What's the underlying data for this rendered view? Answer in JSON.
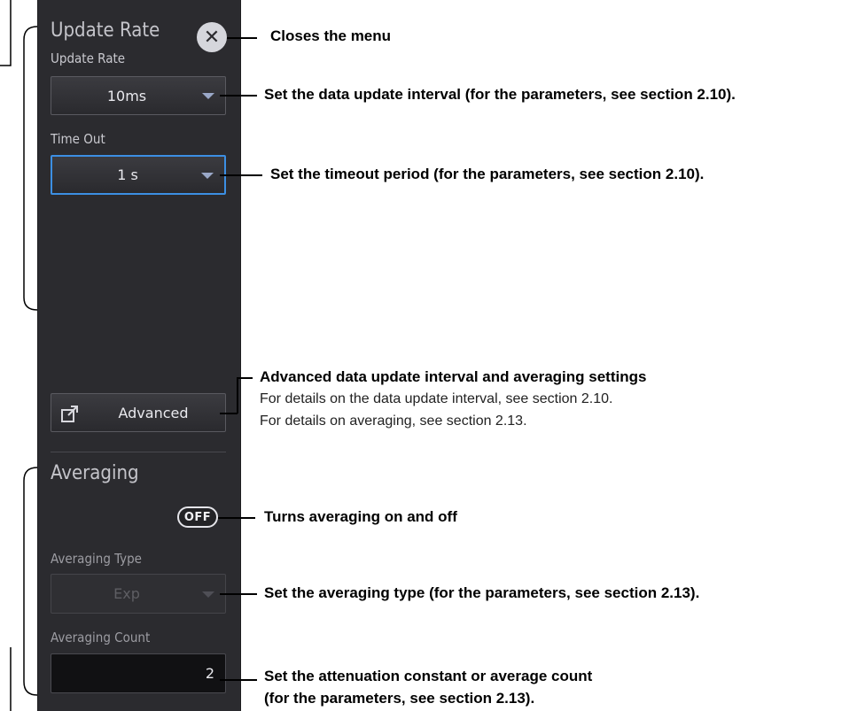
{
  "panel": {
    "header_title": "Update Rate",
    "close_icon": "close-x-icon",
    "update_rate_label": "Update Rate",
    "update_rate_value": "10ms",
    "time_out_label": "Time Out",
    "time_out_value": "1 s",
    "advanced_icon": "external-window-icon",
    "advanced_label": "Advanced",
    "averaging_title": "Averaging",
    "averaging_toggle": "OFF",
    "averaging_type_label": "Averaging Type",
    "averaging_type_value": "Exp",
    "averaging_count_label": "Averaging Count",
    "averaging_count_value": "2"
  },
  "annotations": {
    "close": "Closes the menu",
    "update_rate": "Set the data update interval (for the parameters, see section 2.10).",
    "time_out": "Set the timeout period (for the parameters, see section 2.10).",
    "advanced_title": "Advanced data update interval and averaging settings",
    "advanced_line1": "For details on the data update interval, see section 2.10.",
    "advanced_line2": "For details on averaging, see section 2.13.",
    "toggle": "Turns averaging on and off",
    "averaging_type": "Set the averaging type (for the parameters, see section 2.13).",
    "count_line1": "Set the attenuation constant or average count",
    "count_line2": "(for the parameters, see section 2.13)."
  },
  "colors": {
    "panel_bg": "#2b2b2f",
    "selected_border": "#3c8fe3",
    "dropdown_arrow": "#9aa8c8"
  }
}
